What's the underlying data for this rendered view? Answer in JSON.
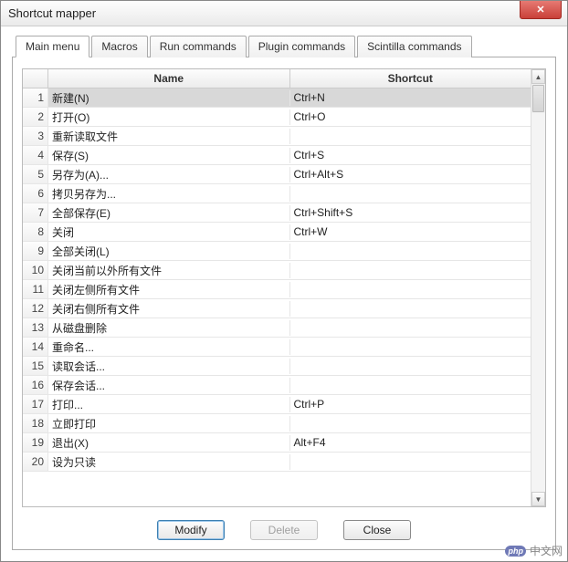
{
  "window": {
    "title": "Shortcut mapper",
    "close_glyph": "✕"
  },
  "tabs": [
    {
      "label": "Main menu",
      "active": true
    },
    {
      "label": "Macros",
      "active": false
    },
    {
      "label": "Run commands",
      "active": false
    },
    {
      "label": "Plugin commands",
      "active": false
    },
    {
      "label": "Scintilla commands",
      "active": false
    }
  ],
  "columns": {
    "name": "Name",
    "shortcut": "Shortcut"
  },
  "rows": [
    {
      "n": "1",
      "name": "新建(N)",
      "shortcut": "Ctrl+N",
      "selected": true
    },
    {
      "n": "2",
      "name": "打开(O)",
      "shortcut": "Ctrl+O"
    },
    {
      "n": "3",
      "name": "重新读取文件",
      "shortcut": ""
    },
    {
      "n": "4",
      "name": "保存(S)",
      "shortcut": "Ctrl+S"
    },
    {
      "n": "5",
      "name": "另存为(A)...",
      "shortcut": "Ctrl+Alt+S"
    },
    {
      "n": "6",
      "name": "拷贝另存为...",
      "shortcut": ""
    },
    {
      "n": "7",
      "name": "全部保存(E)",
      "shortcut": "Ctrl+Shift+S"
    },
    {
      "n": "8",
      "name": "关闭",
      "shortcut": "Ctrl+W"
    },
    {
      "n": "9",
      "name": "全部关闭(L)",
      "shortcut": ""
    },
    {
      "n": "10",
      "name": "关闭当前以外所有文件",
      "shortcut": ""
    },
    {
      "n": "11",
      "name": "关闭左侧所有文件",
      "shortcut": ""
    },
    {
      "n": "12",
      "name": "关闭右侧所有文件",
      "shortcut": ""
    },
    {
      "n": "13",
      "name": "从磁盘删除",
      "shortcut": ""
    },
    {
      "n": "14",
      "name": "重命名...",
      "shortcut": ""
    },
    {
      "n": "15",
      "name": "读取会话...",
      "shortcut": ""
    },
    {
      "n": "16",
      "name": "保存会话...",
      "shortcut": ""
    },
    {
      "n": "17",
      "name": "打印...",
      "shortcut": "Ctrl+P"
    },
    {
      "n": "18",
      "name": "立即打印",
      "shortcut": ""
    },
    {
      "n": "19",
      "name": "退出(X)",
      "shortcut": "Alt+F4"
    },
    {
      "n": "20",
      "name": "设为只读",
      "shortcut": ""
    }
  ],
  "buttons": {
    "modify": "Modify",
    "delete": "Delete",
    "close": "Close"
  },
  "scroll": {
    "up": "▲",
    "down": "▼"
  },
  "watermark": {
    "logo": "php",
    "text": "中文网"
  }
}
